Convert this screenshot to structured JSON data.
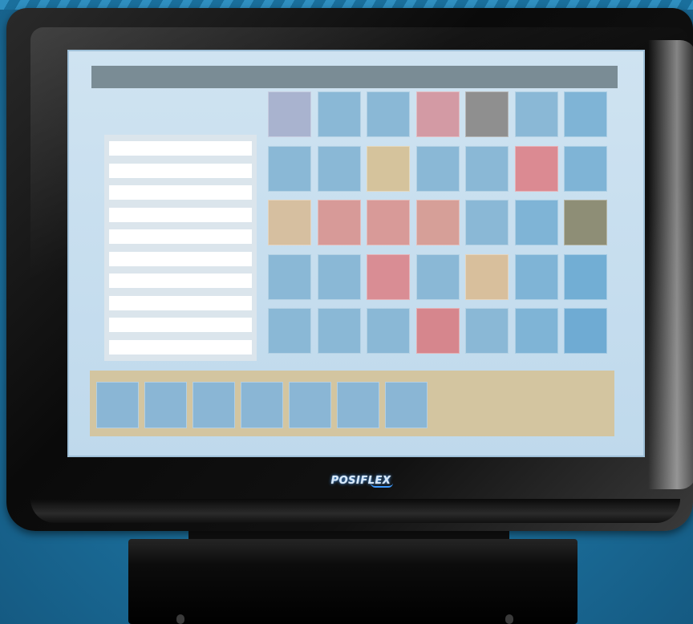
{
  "device": {
    "brand_logo": "POSIFLEX",
    "colors": {
      "background": "#1f77a4",
      "bezel": "#0a0a0a",
      "screen": "#c8dfef",
      "title_bar": "#7a8c95",
      "list_panel": "#dbe5ec",
      "bottom_bar": "#d3c5a0"
    }
  },
  "screen": {
    "title_bar": "",
    "list_rows": [
      "",
      "",
      "",
      "",
      "",
      "",
      "",
      "",
      "",
      ""
    ],
    "key_grid": {
      "rows": 5,
      "columns": 7,
      "key_colors": [
        [
          "#a9b3cf",
          "#8ab8d6",
          "#8ab8d6",
          "#d39aa4",
          "#8f8f8f",
          "#8ab8d6",
          "#7fb4d6"
        ],
        [
          "#8ab8d6",
          "#8ab8d6",
          "#d5c39c",
          "#8ab8d6",
          "#8ab8d6",
          "#db8a92",
          "#7fb4d6"
        ],
        [
          "#d6bfa0",
          "#d79a98",
          "#d89a98",
          "#d69f98",
          "#8ab8d6",
          "#7fb4d6",
          "#8e8e76"
        ],
        [
          "#8ab8d6",
          "#8ab8d6",
          "#d98d94",
          "#8ab8d6",
          "#d8bf9c",
          "#7fb4d6",
          "#72aed4"
        ],
        [
          "#8ab8d6",
          "#8ab8d6",
          "#8ab8d6",
          "#d6868d",
          "#8ab8d6",
          "#7fb4d6",
          "#6fabd3"
        ]
      ]
    },
    "function_keys": [
      "",
      "",
      "",
      "",
      "",
      "",
      ""
    ]
  }
}
